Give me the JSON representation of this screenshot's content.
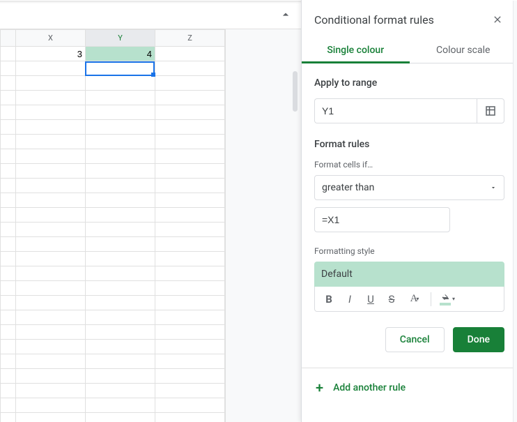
{
  "columns": [
    "X",
    "Y",
    "Z"
  ],
  "cells": {
    "X1": "3",
    "Y1": "4"
  },
  "highlighted_cell": "Y1",
  "selected_cell": "Y2",
  "panel": {
    "title": "Conditional format rules",
    "tabs": {
      "single": "Single colour",
      "scale": "Colour scale"
    },
    "apply_label": "Apply to range",
    "range_value": "Y1",
    "rules_label": "Format rules",
    "cells_if_label": "Format cells if…",
    "condition": "greater than",
    "value": "=X1",
    "style_label": "Formatting style",
    "style_preview": "Default",
    "cancel": "Cancel",
    "done": "Done",
    "add_rule": "Add another rule"
  }
}
